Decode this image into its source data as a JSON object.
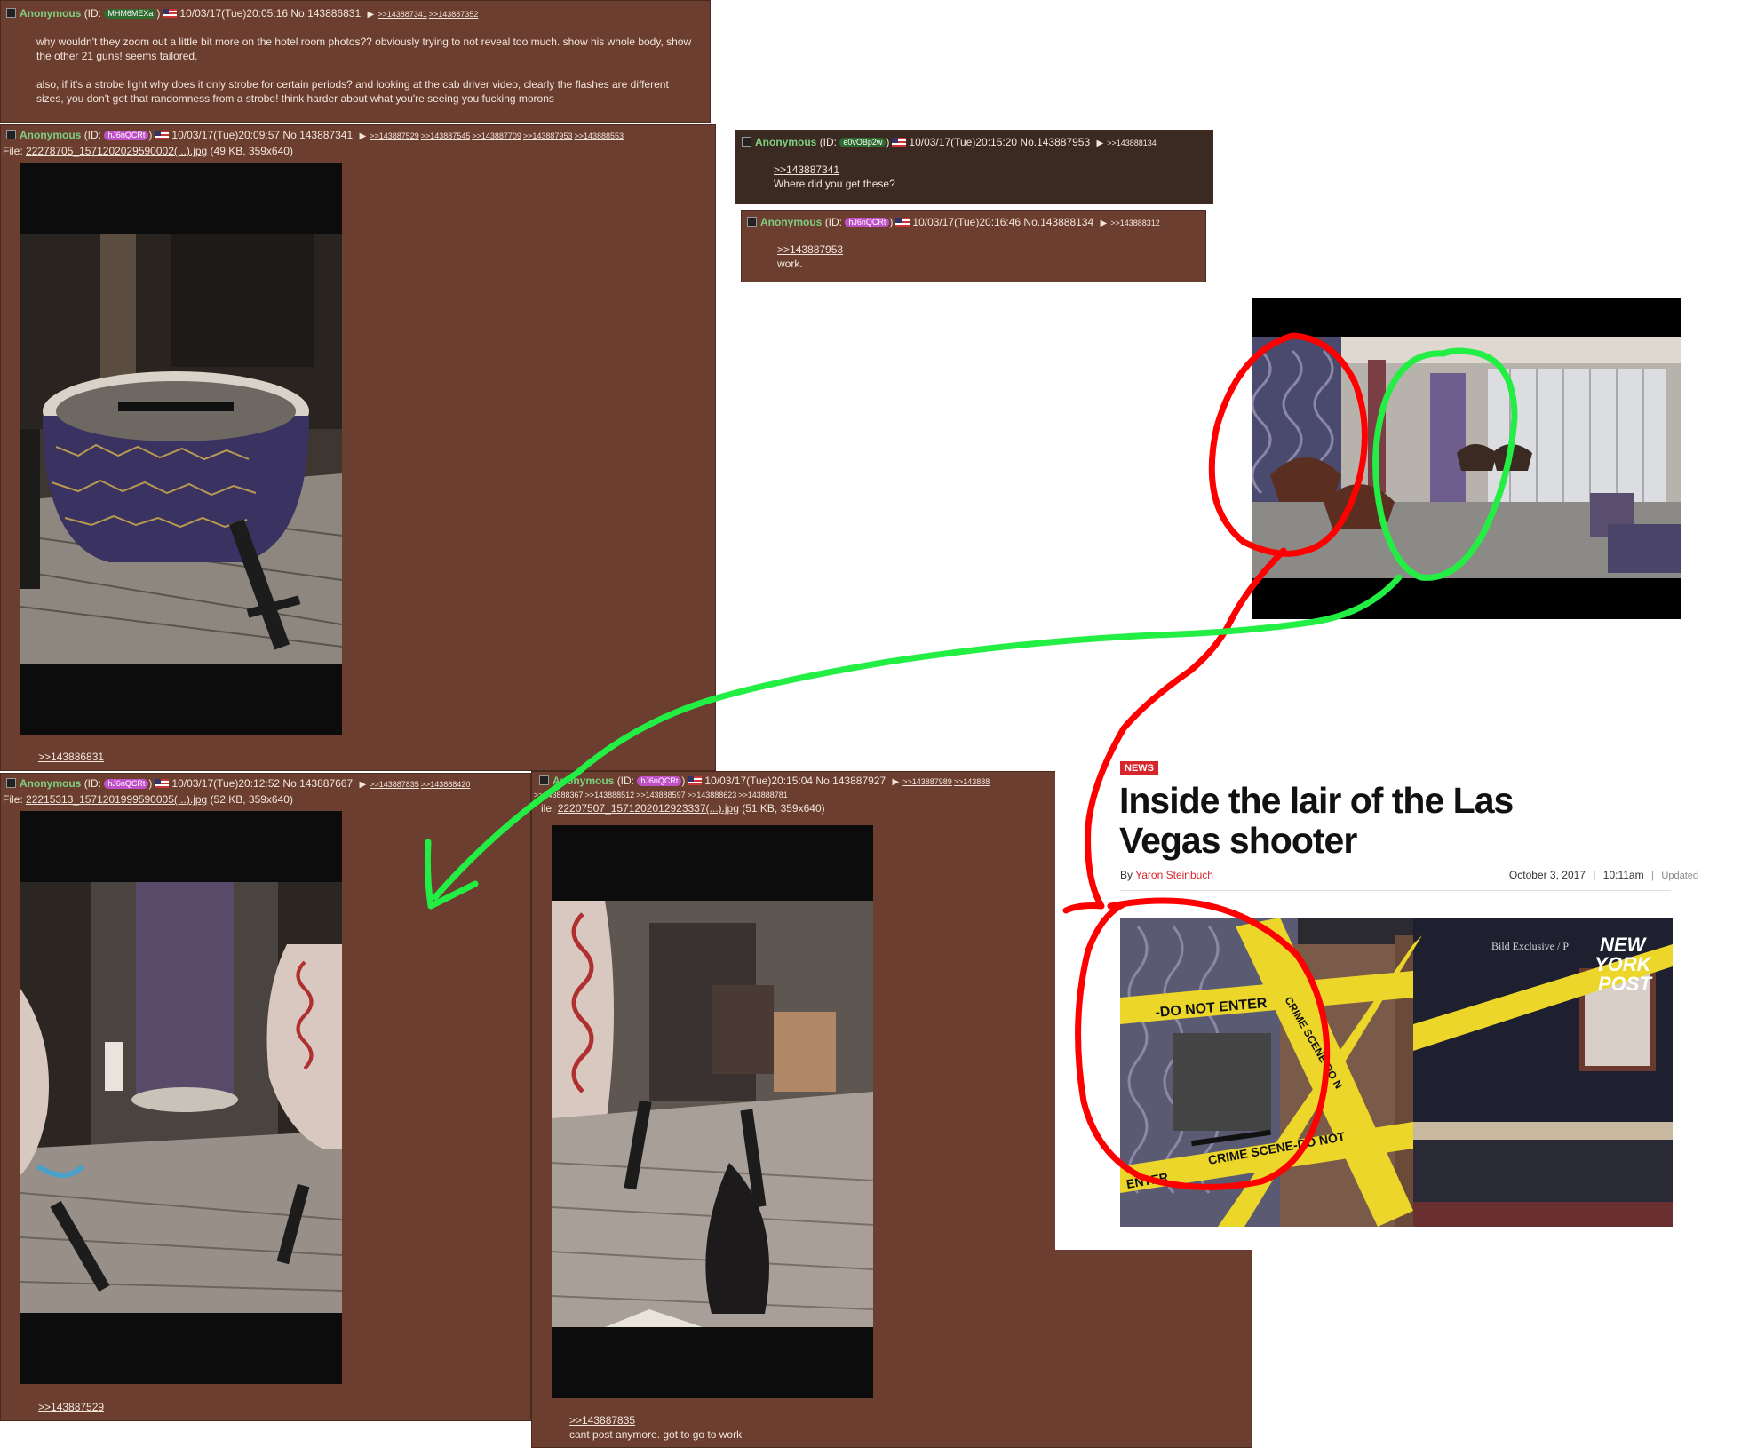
{
  "posts": {
    "p1": {
      "name": "Anonymous",
      "id_prefix": "(ID:",
      "id": "MHM6MEXa",
      "id_suffix": ")",
      "date": "10/03/17(Tue)20:05:16",
      "no": "No.143886831",
      "arrow": "▶",
      "backlinks": [
        ">>143887341",
        ">>143887352"
      ],
      "text1": "why wouldn't they zoom out a little bit more on the hotel room photos?? obviously trying to not reveal too much. show his whole body, show the other 21 guns! seems tailored.",
      "text2": "also, if it's a strobe light why does it only strobe for certain periods? and looking at the cab driver video, clearly the flashes are different sizes, you don't get that randomness from a strobe! think harder about what you're seeing you fucking morons"
    },
    "p2": {
      "name": "Anonymous",
      "id_prefix": "(ID:",
      "id": "hJ6nQCRt",
      "id_suffix": ")",
      "date": "10/03/17(Tue)20:09:57",
      "no": "No.143887341",
      "arrow": "▶",
      "backlinks": [
        ">>143887529",
        ">>143887545",
        ">>143887709",
        ">>143887953",
        ">>143888553"
      ],
      "file_label": "File:",
      "file_name": "22278705_1571202029590002(...).jpg",
      "file_info": "(49 KB, 359x640)",
      "quote": ">>143886831"
    },
    "p3": {
      "name": "Anonymous",
      "id_prefix": "(ID:",
      "id": "e0vOBp2w",
      "id_suffix": ")",
      "date": "10/03/17(Tue)20:15:20",
      "no": "No.143887953",
      "arrow": "▶",
      "backlinks": [
        ">>143888134"
      ],
      "quote": ">>143887341",
      "text": "Where did you get these?"
    },
    "p4": {
      "name": "Anonymous",
      "id_prefix": "(ID:",
      "id": "hJ6nQCRt",
      "id_suffix": ")",
      "date": "10/03/17(Tue)20:16:46",
      "no": "No.143888134",
      "arrow": "▶",
      "backlinks": [
        ">>143888312"
      ],
      "quote": ">>143887953",
      "text": "work."
    },
    "p5": {
      "name": "Anonymous",
      "id_prefix": "(ID:",
      "id": "hJ6nQCRt",
      "id_suffix": ")",
      "date": "10/03/17(Tue)20:12:52",
      "no": "No.143887667",
      "arrow": "▶",
      "backlinks": [
        ">>143887835",
        ">>143888420"
      ],
      "file_label": "File:",
      "file_name": "22215313_1571201999590005(...).jpg",
      "file_info": "(52 KB, 359x640)",
      "quote": ">>143887529"
    },
    "p6": {
      "name": "Anonymous",
      "id_prefix": "(ID:",
      "id": "hJ6nQCRt",
      "id_suffix": ")",
      "date": "10/03/17(Tue)20:15:04",
      "no": "No.143887927",
      "arrow": "▶",
      "backlinks": [
        ">>143887989",
        ">>143888"
      ],
      "backlinks2": [
        ">>143888367",
        ">>143888512",
        ">>143888597",
        ">>143888623",
        ">>143888781"
      ],
      "file_label": "ile:",
      "file_name": "22207507_1571202012923337(...).jpg",
      "file_info": "(51 KB, 359x640)",
      "quote": ">>143887835",
      "text": "cant post anymore. got to go to work"
    }
  },
  "article": {
    "badge": "NEWS",
    "headline_line1": "Inside the lair of the Las",
    "headline_line2": "Vegas shooter",
    "by": "By",
    "author": "Yaron Steinbuch",
    "date": "October 3, 2017",
    "sep": "|",
    "time": "10:11am",
    "updated": "Updated",
    "photo_credit": "Bild Exclusive / P",
    "logo_line1": "NEW",
    "logo_line2": "YORK",
    "logo_line3": "POST",
    "tape_text1": "-DO NOT ENTER",
    "tape_text2": "CRIME SCENE-DO N",
    "tape_text3": "CRIME SCENE-DO NOT",
    "tape_text4": "ENTER"
  },
  "colors": {
    "post_bg": "#6b3e30",
    "post_dark_bg": "#3a2a22",
    "name": "#7fcf7f",
    "id_pink": "#c050c8",
    "id_green": "#2f6b2f",
    "article_red": "#d6262c",
    "annotation_red": "#ff0000",
    "annotation_green": "#22ee44"
  }
}
